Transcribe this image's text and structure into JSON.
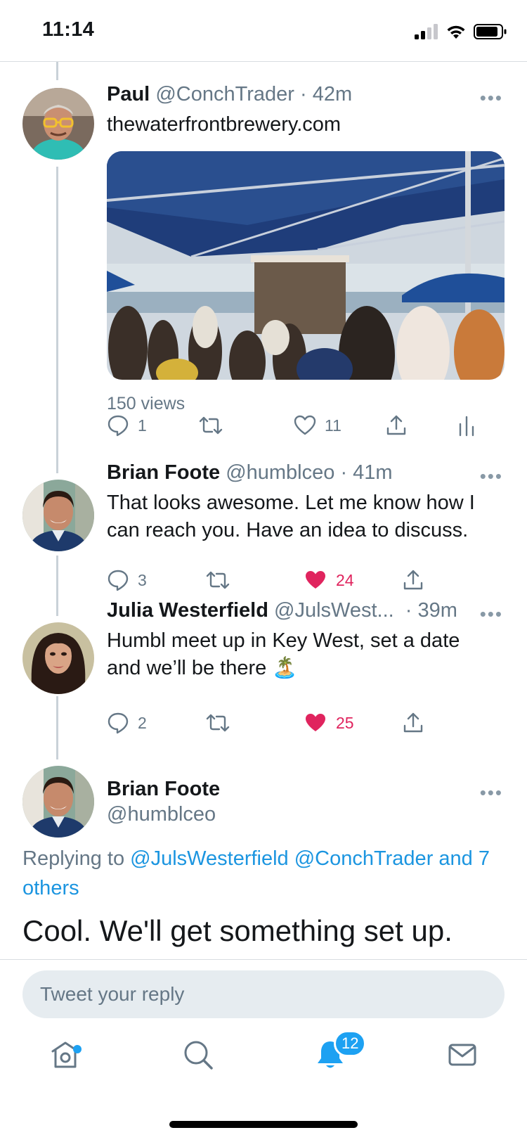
{
  "status_bar": {
    "time": "11:14"
  },
  "thread": [
    {
      "name": "Paul",
      "handle": "@ConchTrader",
      "time": "· 42m",
      "link": "thewaterfrontbrewery.com",
      "views": "150 views",
      "reply_count": "1",
      "retweet_count": "",
      "like_count": "11",
      "liked": false
    },
    {
      "name": "Brian Foote",
      "handle": "@humblceo",
      "time": "· 41m",
      "text_line1": "That looks awesome. Let me know how I",
      "text_line2": "can reach you. Have an idea to discuss.",
      "reply_count": "3",
      "like_count": "24",
      "liked": true
    },
    {
      "name": "Julia Westerfield",
      "handle": "@JulsWest...",
      "time": "· 39m",
      "text_line1": "Humbl meet up in Key West, set a date",
      "text_line2": "and we’ll be there 🏝️",
      "reply_count": "2",
      "like_count": "25",
      "liked": true
    }
  ],
  "focused_tweet": {
    "name": "Brian Foote",
    "handle": "@humblceo",
    "replying_prefix": "Replying to",
    "replying_to": "@JulsWesterfield @ConchTrader and",
    "replying_others": "7 others",
    "text": "Cool. We'll get something set up."
  },
  "compose": {
    "placeholder": "Tweet your reply"
  },
  "tabbar": {
    "items": [
      "home-icon",
      "search-icon",
      "bell-icon",
      "mail-icon"
    ],
    "notifications_badge": "12"
  },
  "colors": {
    "accent": "#1da1f2",
    "link": "#1b95e0",
    "like": "#e0245e",
    "muted": "#657786"
  }
}
